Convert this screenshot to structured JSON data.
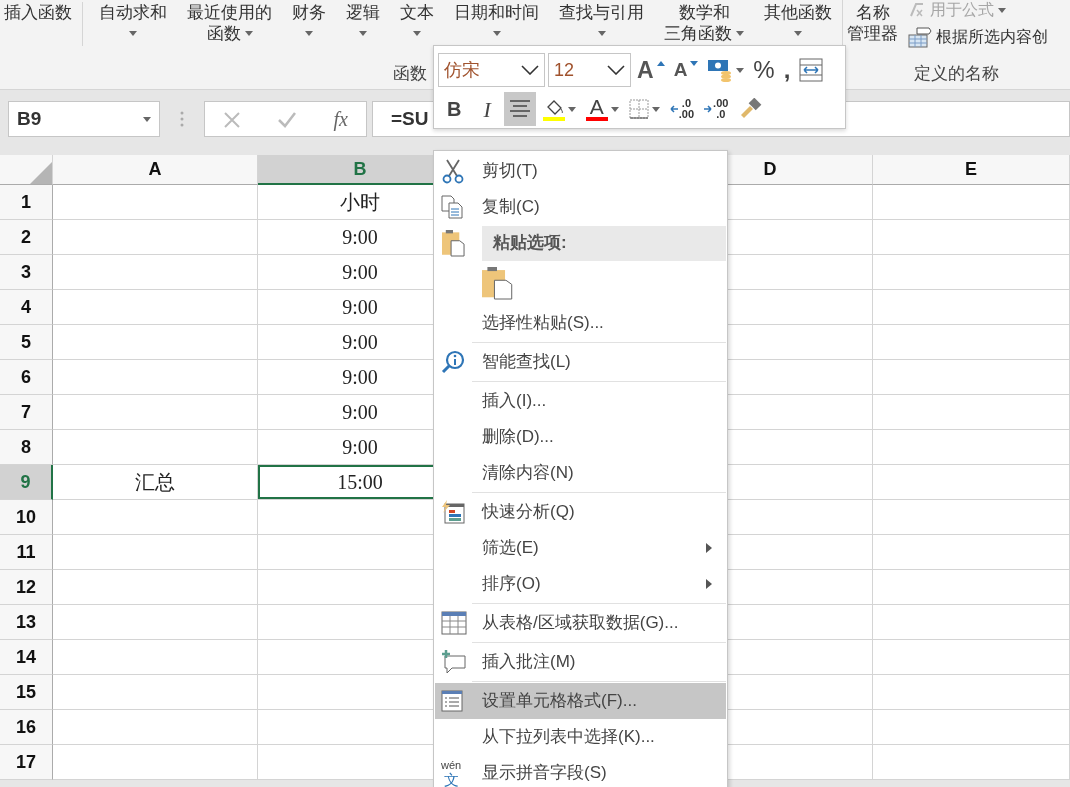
{
  "ribbon": {
    "groups": [
      {
        "label": "函数",
        "buttons": [
          {
            "kind": "large",
            "lines": [
              "插入函数"
            ],
            "dropdown": false
          },
          {
            "kind": "large",
            "lines": [
              "自动求和"
            ],
            "dropdown": true
          },
          {
            "kind": "large",
            "lines": [
              "最近使用的",
              "函数"
            ],
            "dropdown": true
          },
          {
            "kind": "large",
            "lines": [
              "财务"
            ],
            "dropdown": true
          },
          {
            "kind": "large",
            "lines": [
              "逻辑"
            ],
            "dropdown": true
          },
          {
            "kind": "large",
            "lines": [
              "文本"
            ],
            "dropdown": true
          },
          {
            "kind": "large",
            "lines": [
              "日期和时间"
            ],
            "dropdown": true
          },
          {
            "kind": "large",
            "lines": [
              "查找与引用"
            ],
            "dropdown": true
          },
          {
            "kind": "large",
            "lines": [
              "数学和",
              "三角函数"
            ],
            "dropdown": true
          },
          {
            "kind": "large",
            "lines": [
              "其他函数"
            ],
            "dropdown": true
          }
        ]
      },
      {
        "label": "定义的名称",
        "buttons": [
          {
            "kind": "large",
            "lines": [
              "名称",
              "管理器"
            ],
            "dropdown": false
          },
          {
            "kind": "small",
            "lines": [
              "用于公式"
            ],
            "dropdown": true,
            "disabled": true
          },
          {
            "kind": "small",
            "lines": [
              "根据所选内容创"
            ],
            "dropdown": false,
            "disabled": false
          }
        ]
      }
    ]
  },
  "formula_bar": {
    "name_box": "B9",
    "fx": "fx",
    "formula": "=SU"
  },
  "sheet": {
    "columns": [
      {
        "label": "A",
        "selected": false
      },
      {
        "label": "B",
        "selected": true
      },
      {
        "label": "D",
        "selected": false
      },
      {
        "label": "E",
        "selected": false
      }
    ],
    "rows": [
      {
        "label": "1",
        "selected": false,
        "b": "小时",
        "b_active": false
      },
      {
        "label": "2",
        "selected": false,
        "b": "9:00",
        "b_active": false
      },
      {
        "label": "3",
        "selected": false,
        "b": "9:00",
        "b_active": false
      },
      {
        "label": "4",
        "selected": false,
        "b": "9:00",
        "b_active": false
      },
      {
        "label": "5",
        "selected": false,
        "b": "9:00",
        "b_active": false
      },
      {
        "label": "6",
        "selected": false,
        "b": "9:00",
        "b_active": false
      },
      {
        "label": "7",
        "selected": false,
        "b": "9:00",
        "b_active": false
      },
      {
        "label": "8",
        "selected": false,
        "b": "9:00",
        "b_active": false
      },
      {
        "label": "9",
        "selected": true,
        "a": "汇总",
        "b": "15:00",
        "b_active": true
      },
      {
        "label": "10",
        "selected": false,
        "b_active": false
      },
      {
        "label": "11",
        "selected": false,
        "b_active": false
      },
      {
        "label": "12",
        "selected": false,
        "b_active": false
      },
      {
        "label": "13",
        "selected": false,
        "b_active": false
      },
      {
        "label": "14",
        "selected": false,
        "b_active": false
      },
      {
        "label": "15",
        "selected": false,
        "b_active": false
      },
      {
        "label": "16",
        "selected": false,
        "b_active": false
      },
      {
        "label": "17",
        "selected": false,
        "b_active": false
      }
    ]
  },
  "mini_toolbar": {
    "font": "仿宋",
    "size": "12",
    "row1": [
      {
        "kind": "grow",
        "text": "A"
      },
      {
        "kind": "shrink",
        "text": "A"
      },
      {
        "kind": "accounting",
        "dropdown": true
      },
      {
        "kind": "percent",
        "text": "%"
      },
      {
        "kind": "comma",
        "text": ","
      },
      {
        "kind": "wrap"
      }
    ],
    "row2": [
      {
        "kind": "bold",
        "text": "B",
        "selected": false
      },
      {
        "kind": "italic",
        "text": "I",
        "selected": false
      },
      {
        "kind": "align",
        "selected": true
      },
      {
        "kind": "fill",
        "color": "#ffff00",
        "dropdown": true
      },
      {
        "kind": "fontcolor",
        "text": "A",
        "color": "#ff0000",
        "dropdown": true
      },
      {
        "kind": "borders",
        "dropdown": true
      },
      {
        "kind": "decup",
        "lines": [
          ".0",
          ".00"
        ]
      },
      {
        "kind": "decdown",
        "lines": [
          ".00",
          ".0"
        ]
      },
      {
        "kind": "painter"
      }
    ]
  },
  "context_menu": {
    "items": [
      {
        "kind": "item",
        "label": "剪切(T)",
        "selected": false,
        "submenu": false
      },
      {
        "kind": "item",
        "label": "复制(C)",
        "selected": false,
        "submenu": false
      },
      {
        "kind": "header",
        "label": "粘贴选项:"
      },
      {
        "kind": "paste"
      },
      {
        "kind": "item",
        "label": "选择性粘贴(S)...",
        "selected": false,
        "submenu": false
      },
      {
        "kind": "separator"
      },
      {
        "kind": "item",
        "label": "智能查找(L)",
        "selected": false,
        "submenu": false
      },
      {
        "kind": "separator"
      },
      {
        "kind": "item",
        "label": "插入(I)...",
        "selected": false,
        "submenu": false
      },
      {
        "kind": "item",
        "label": "删除(D)...",
        "selected": false,
        "submenu": false
      },
      {
        "kind": "item",
        "label": "清除内容(N)",
        "selected": false,
        "submenu": false
      },
      {
        "kind": "separator"
      },
      {
        "kind": "item",
        "label": "快速分析(Q)",
        "selected": false,
        "submenu": false
      },
      {
        "kind": "item",
        "label": "筛选(E)",
        "selected": false,
        "submenu": true
      },
      {
        "kind": "item",
        "label": "排序(O)",
        "selected": false,
        "submenu": true
      },
      {
        "kind": "separator"
      },
      {
        "kind": "item",
        "label": "从表格/区域获取数据(G)...",
        "selected": false,
        "submenu": false
      },
      {
        "kind": "separator"
      },
      {
        "kind": "item",
        "label": "插入批注(M)",
        "selected": false,
        "submenu": false
      },
      {
        "kind": "separator"
      },
      {
        "kind": "item",
        "label": "设置单元格格式(F)...",
        "selected": true,
        "submenu": false
      },
      {
        "kind": "item",
        "label": "从下拉列表中选择(K)...",
        "selected": false,
        "submenu": false
      },
      {
        "kind": "item",
        "label": "显示拼音字段(S)",
        "selected": false,
        "submenu": false,
        "icon_lines": [
          "wén",
          "文"
        ]
      }
    ]
  }
}
